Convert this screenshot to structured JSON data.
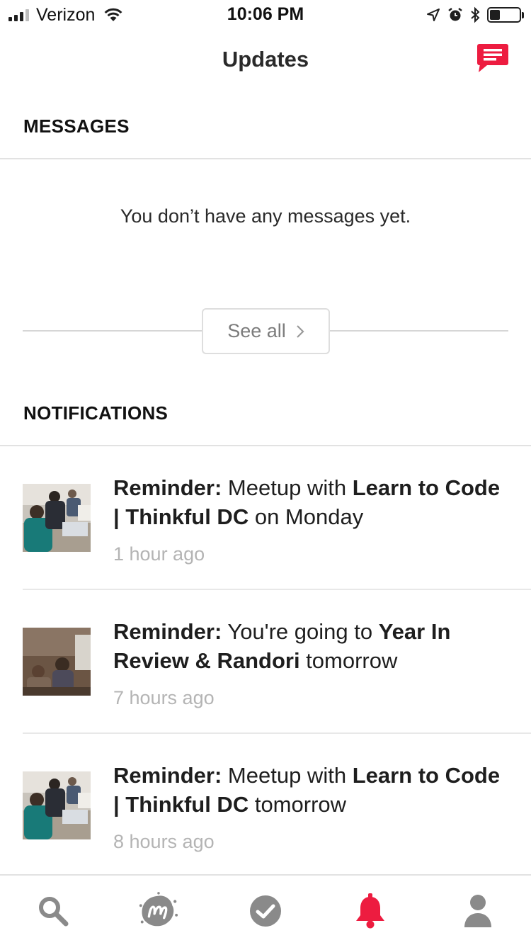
{
  "status_bar": {
    "carrier": "Verizon",
    "time": "10:06 PM",
    "battery_level": 0.35
  },
  "header": {
    "title": "Updates",
    "compose_icon": "chat-bubble-icon",
    "accent_color": "#ed1c40"
  },
  "messages": {
    "section_title": "MESSAGES",
    "empty_text": "You don’t have any messages yet.",
    "see_all_label": "See all"
  },
  "notifications": {
    "section_title": "NOTIFICATIONS",
    "items": [
      {
        "prefix": "Reminder:",
        "text_1": " Meetup with ",
        "bold_1": "Learn to Code | Thinkful DC",
        "text_2": " on Monday",
        "time": "1 hour ago"
      },
      {
        "prefix": "Reminder:",
        "text_1": " You're going to ",
        "bold_1": "Year In Review & Randori",
        "text_2": " tomorrow",
        "time": "7 hours ago"
      },
      {
        "prefix": "Reminder:",
        "text_1": " Meetup with ",
        "bold_1": "Learn to Code | Thinkful DC",
        "text_2": " tomorrow",
        "time": "8 hours ago"
      }
    ]
  },
  "tab_bar": {
    "tabs": [
      "search-icon",
      "meetup-logo-icon",
      "check-circle-icon",
      "bell-icon",
      "profile-icon"
    ],
    "active_tab": "bell-icon",
    "active_color": "#ed1c40",
    "inactive_color": "#8a8a8a"
  }
}
